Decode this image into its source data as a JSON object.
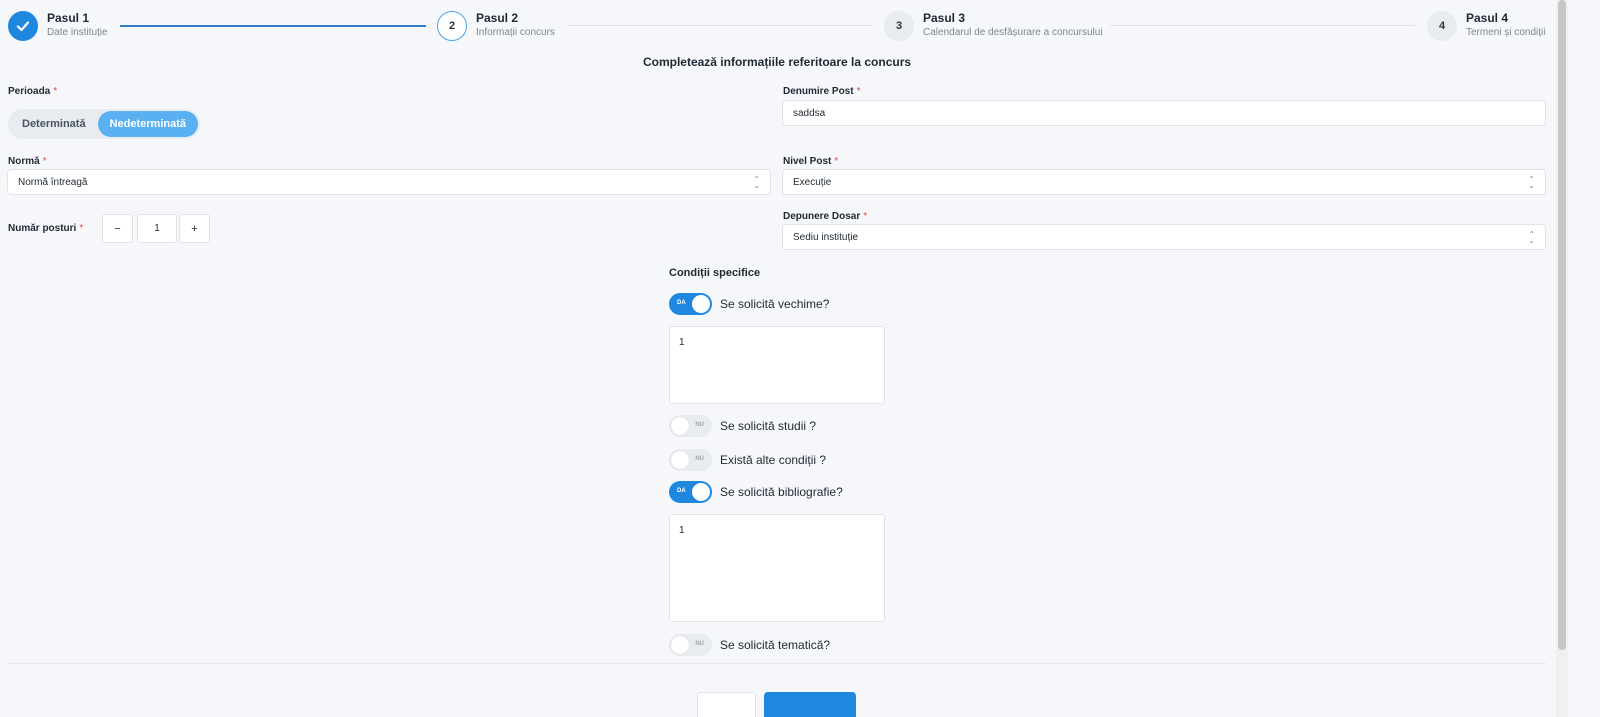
{
  "stepper": {
    "steps": [
      {
        "title": "Pasul 1",
        "subtitle": "Date instituție",
        "state": "done"
      },
      {
        "title": "Pasul 2",
        "subtitle": "Informații concurs",
        "number": "2",
        "state": "active"
      },
      {
        "title": "Pasul 3",
        "subtitle": "Calendarul de desfășurare a concursului",
        "number": "3",
        "state": "idle"
      },
      {
        "title": "Pasul 4",
        "subtitle": "Termeni și condiții",
        "number": "4",
        "state": "idle"
      }
    ]
  },
  "form": {
    "heading": "Completează informațiile referitoare la concurs",
    "required_mark": "*",
    "perioada": {
      "label": "Perioada",
      "options": [
        "Determinată",
        "Nedeterminată"
      ],
      "selected": "Nedeterminată"
    },
    "denumire_post": {
      "label": "Denumire Post",
      "value": "saddsa"
    },
    "norma": {
      "label": "Normă",
      "value": "Normă întreagă"
    },
    "nivel_post": {
      "label": "Nivel Post",
      "value": "Execuție"
    },
    "numar_posturi": {
      "label": "Număr posturi",
      "value": "1",
      "minus": "−",
      "plus": "+"
    },
    "depunere_dosar": {
      "label": "Depunere Dosar",
      "value": "Sediu instituție"
    }
  },
  "conditii": {
    "heading": "Condiții specifice",
    "items": [
      {
        "label": "Se solicită vechime?",
        "state": "DA",
        "on": true,
        "text": "1"
      },
      {
        "label": "Se solicită studii ?",
        "state": "NU",
        "on": false
      },
      {
        "label": "Există alte condiții ?",
        "state": "NU",
        "on": false
      },
      {
        "label": "Se solicită bibliografie?",
        "state": "DA",
        "on": true,
        "text": "1"
      },
      {
        "label": "Se solicită tematică?",
        "state": "NU",
        "on": false
      }
    ]
  },
  "colors": {
    "accent": "#1f87dd",
    "segment_active": "#5ab1f2",
    "required": "#e04848"
  }
}
